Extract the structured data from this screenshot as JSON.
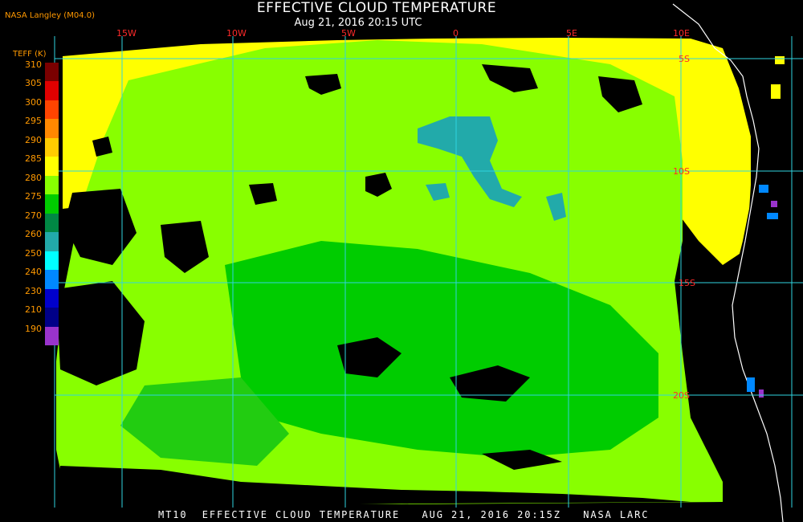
{
  "header": {
    "title": "EFFECTIVE CLOUD TEMPERATURE",
    "subtitle": "Aug 21, 2016 20:15 UTC",
    "producer": "NASA Langley (M04.0)"
  },
  "footer": {
    "text": "MT10  EFFECTIVE CLOUD TEMPERATURE   AUG 21, 2016 20:15Z   NASA LARC"
  },
  "color_scale": {
    "title": "TEFF (K)",
    "levels": [
      "310",
      "305",
      "300",
      "295",
      "290",
      "285",
      "280",
      "275",
      "270",
      "260",
      "250",
      "240",
      "230",
      "210",
      "190"
    ],
    "colors": [
      "#7a0000",
      "#e00000",
      "#ff4400",
      "#ff8800",
      "#ffcc00",
      "#ffff00",
      "#88ff00",
      "#00cc00",
      "#008844",
      "#22aaaa",
      "#00ffff",
      "#0088ff",
      "#0000cc",
      "#000088",
      "#9933cc"
    ]
  },
  "map": {
    "background_color": "#000000",
    "grid_color": "#2fd4e0",
    "coast_color": "#ffffff",
    "longitude_labels": [
      "15W",
      "10W",
      "5W",
      "0",
      "5E",
      "10E"
    ],
    "latitude_labels": [
      "5S",
      "10S",
      "15S",
      "20S"
    ],
    "label_color": "#ff2a2a"
  }
}
